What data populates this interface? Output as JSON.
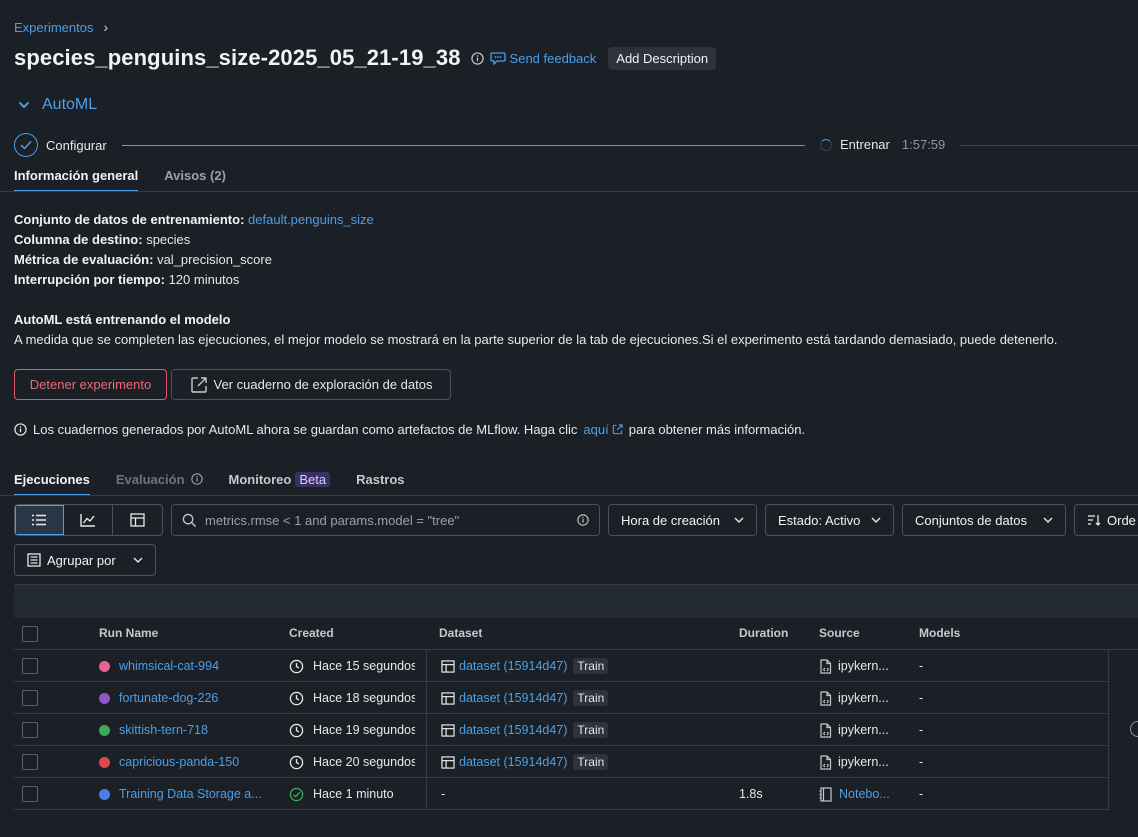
{
  "breadcrumb": {
    "parent": "Experimentos"
  },
  "header": {
    "title": "species_penguins_size-2025_05_21-19_38",
    "feedback_label": "Send feedback",
    "add_description_label": "Add Description"
  },
  "automl": {
    "label": "AutoML"
  },
  "stepper": {
    "step1_label": "Configurar",
    "step2_label": "Entrenar",
    "step2_time": "1:57:59"
  },
  "overview_tabs": [
    {
      "label": "Información general",
      "active": true
    },
    {
      "label": "Avisos (2)",
      "active": false
    }
  ],
  "meta": {
    "dataset_label": "Conjunto de datos de entrenamiento:",
    "dataset_value": "default.penguins_size",
    "target_label": "Columna de destino:",
    "target_value": "species",
    "metric_label": "Métrica de evaluación:",
    "metric_value": "val_precision_score",
    "timeout_label": "Interrupción por tiempo:",
    "timeout_value": "120 minutos"
  },
  "training": {
    "title": "AutoML está entrenando el modelo",
    "description": "A medida que se completen las ejecuciones, el mejor modelo se mostrará en la parte superior de la tab de ejecuciones.Si el experimento está tardando demasiado, puede detenerlo."
  },
  "actions": {
    "stop_label": "Detener experimento",
    "notebook_label": "Ver cuaderno de exploración de datos"
  },
  "notice": {
    "text_before": "Los cuadernos generados por AutoML ahora se guardan como artefactos de MLflow. Haga clic",
    "link": "aquí",
    "text_after": "para obtener más información."
  },
  "runs_tabs": {
    "runs": "Ejecuciones",
    "evaluation": "Evaluación",
    "monitoring": "Monitoreo",
    "beta": "Beta",
    "traces": "Rastros"
  },
  "toolbar": {
    "search_placeholder": "metrics.rmse < 1 and params.model = \"tree\"",
    "created_label": "Hora de creación",
    "state_label": "Estado: Activo",
    "datasets_label": "Conjuntos de datos",
    "order_label": "Orde",
    "group_label": "Agrupar por"
  },
  "table": {
    "columns": {
      "run_name": "Run Name",
      "created": "Created",
      "dataset": "Dataset",
      "duration": "Duration",
      "source": "Source",
      "models": "Models"
    },
    "rows": [
      {
        "name": "whimsical-cat-994",
        "color": "#e8648e",
        "created": "Hace 15 segundos",
        "status": "running",
        "dataset": "dataset (15914d47)",
        "dataset_tag": "Train",
        "duration": "",
        "source": "ipykern...",
        "source_kind": "kernel",
        "models": "-"
      },
      {
        "name": "fortunate-dog-226",
        "color": "#8e55c8",
        "created": "Hace 18 segundos",
        "status": "running",
        "dataset": "dataset (15914d47)",
        "dataset_tag": "Train",
        "duration": "",
        "source": "ipykern...",
        "source_kind": "kernel",
        "models": "-"
      },
      {
        "name": "skittish-tern-718",
        "color": "#3bab5a",
        "created": "Hace 19 segundos",
        "status": "running",
        "dataset": "dataset (15914d47)",
        "dataset_tag": "Train",
        "duration": "",
        "source": "ipykern...",
        "source_kind": "kernel",
        "models": "-"
      },
      {
        "name": "capricious-panda-150",
        "color": "#e04848",
        "created": "Hace 20 segundos",
        "status": "running",
        "dataset": "dataset (15914d47)",
        "dataset_tag": "Train",
        "duration": "",
        "source": "ipykern...",
        "source_kind": "kernel",
        "models": "-"
      },
      {
        "name": "Training Data Storage a...",
        "color": "#4a7ee8",
        "created": "Hace 1 minuto",
        "status": "finished",
        "dataset": "-",
        "dataset_tag": "",
        "duration": "1.8s",
        "source": "Notebo...",
        "source_kind": "notebook",
        "models": "-"
      }
    ]
  },
  "colors": {
    "background": "#1b2027",
    "link": "#4c9ee8",
    "danger": "#e05b67",
    "success": "#3bab5a"
  }
}
